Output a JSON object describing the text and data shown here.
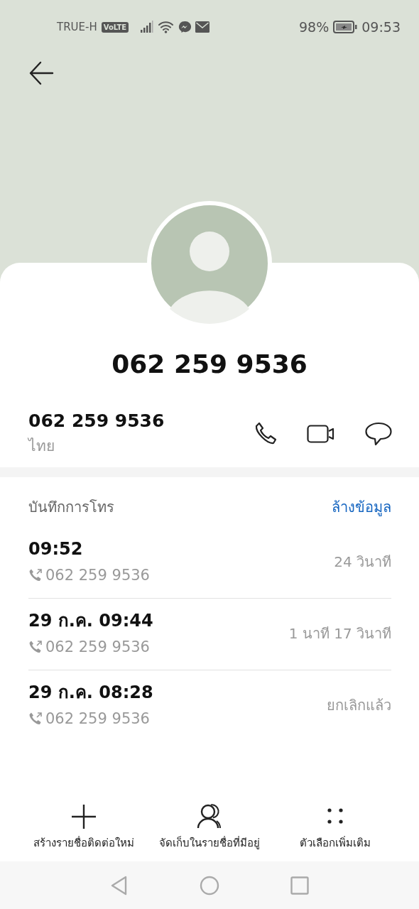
{
  "status_bar": {
    "carrier": "TRUE-H",
    "network_badge": "VoLTE",
    "battery": "98%",
    "time": "09:53"
  },
  "contact": {
    "title": "062 259 9536",
    "number": "062 259 9536",
    "location": "ไทย"
  },
  "call_log": {
    "title": "บันทึกการโทร",
    "clear_link": "ล้างข้อมูล",
    "entries": [
      {
        "time": "09:52",
        "number": "062 259 9536",
        "detail": "24 วินาที"
      },
      {
        "time": "29 ก.ค. 09:44",
        "number": "062 259 9536",
        "detail": "1 นาที 17 วินาที"
      },
      {
        "time": "29 ก.ค. 08:28",
        "number": "062 259 9536",
        "detail": "ยกเลิกแล้ว"
      }
    ]
  },
  "actions": [
    {
      "kind": "add",
      "label": "สร้างรายชื่อติดต่อใหม่"
    },
    {
      "kind": "contacts",
      "label": "จัดเก็บในรายชื่อที่มีอยู่"
    },
    {
      "kind": "more",
      "label": "ตัวเลือกเพิ่มเติม"
    }
  ]
}
